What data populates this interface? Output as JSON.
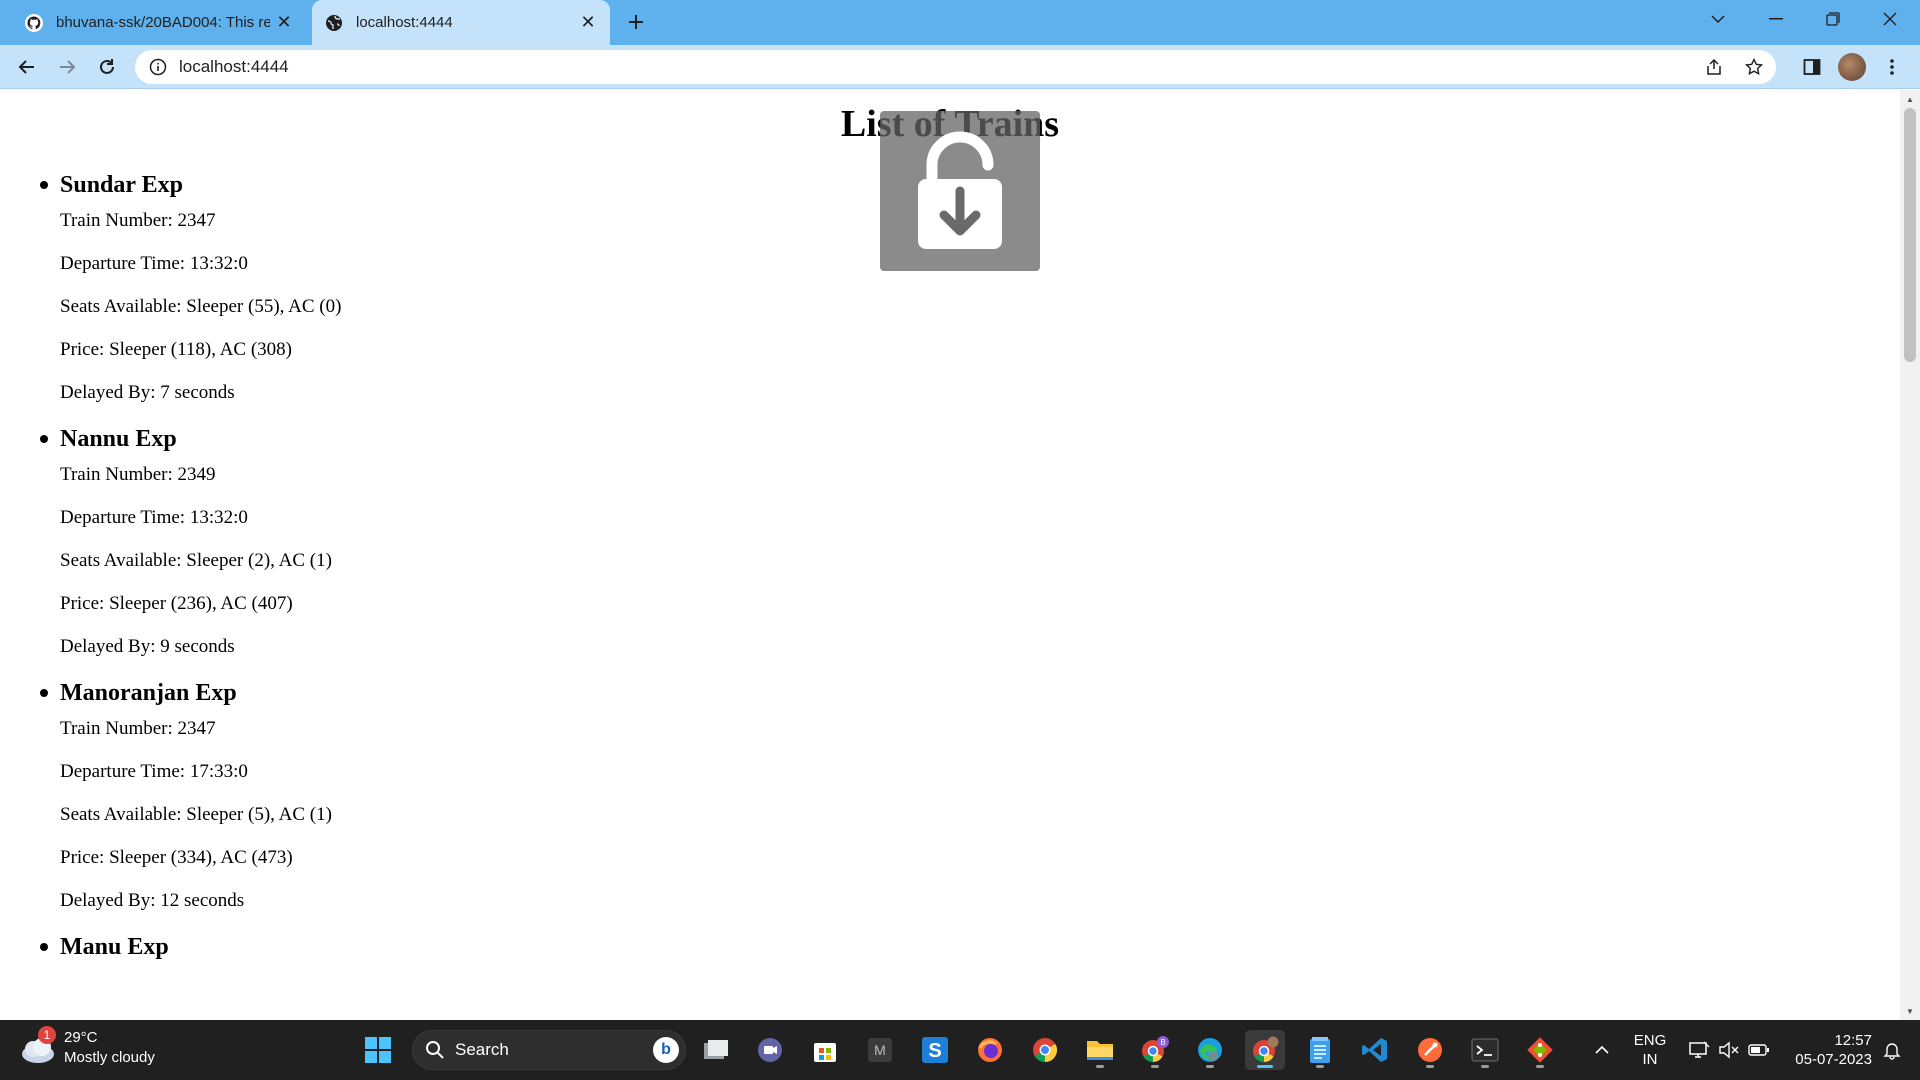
{
  "browser": {
    "tabs": [
      {
        "title": "bhuvana-ssk/20BAD004: This repo",
        "favicon": "github-icon"
      },
      {
        "title": "localhost:4444",
        "favicon": "globe-icon"
      }
    ],
    "address": "localhost:4444"
  },
  "page": {
    "heading": "List of Trains",
    "trains": [
      {
        "name": "Sundar Exp",
        "train_number": "Train Number: 2347",
        "departure": "Departure Time: 13:32:0",
        "seats": "Seats Available: Sleeper (55), AC (0)",
        "price": "Price: Sleeper (118), AC (308)",
        "delay": "Delayed By: 7 seconds"
      },
      {
        "name": "Nannu Exp",
        "train_number": "Train Number: 2349",
        "departure": "Departure Time: 13:32:0",
        "seats": "Seats Available: Sleeper (2), AC (1)",
        "price": "Price: Sleeper (236), AC (407)",
        "delay": "Delayed By: 9 seconds"
      },
      {
        "name": "Manoranjan Exp",
        "train_number": "Train Number: 2347",
        "departure": "Departure Time: 17:33:0",
        "seats": "Seats Available: Sleeper (5), AC (1)",
        "price": "Price: Sleeper (334), AC (473)",
        "delay": "Delayed By: 12 seconds"
      },
      {
        "name": "Manu Exp"
      }
    ]
  },
  "taskbar": {
    "weather": {
      "temp": "29°C",
      "condition": "Mostly cloudy",
      "badge": "1"
    },
    "search_label": "Search",
    "language": {
      "line1": "ENG",
      "line2": "IN"
    },
    "clock": {
      "time": "12:57",
      "date": "05-07-2023"
    }
  },
  "colors": {
    "titlebar": "#5eb1ec",
    "toolbar": "#c4e3fb",
    "taskbar": "#202020"
  }
}
